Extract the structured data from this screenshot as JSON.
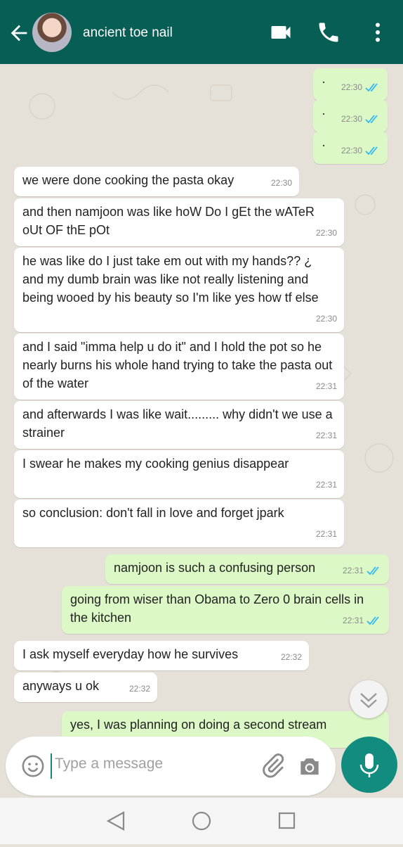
{
  "header": {
    "contact_name": "ancient toe nail",
    "icons": [
      "back-arrow-icon",
      "avatar",
      "video-call-icon",
      "phone-icon",
      "more-vert-icon"
    ],
    "color": "#075e54"
  },
  "messages": [
    {
      "dir": "out",
      "text": "·",
      "time": "22:30",
      "status": "read"
    },
    {
      "dir": "out",
      "text": "·",
      "time": "22:30",
      "status": "read"
    },
    {
      "dir": "out",
      "text": "·",
      "time": "22:30",
      "status": "read"
    },
    {
      "dir": "in",
      "text": "we were done cooking the pasta okay",
      "time": "22:30"
    },
    {
      "dir": "in",
      "text": "and then namjoon was like hoW Do I gEt the wATeR oUt OF thE pOt",
      "time": "22:30"
    },
    {
      "dir": "in",
      "text": "he was like do I just take em out with my hands?? ¿ and my dumb brain was like not really listening and being wooed by his beauty so I'm like yes how tf else",
      "time": "22:30"
    },
    {
      "dir": "in",
      "text": "and I said \"imma help u do it\" and I hold the pot so he nearly burns his whole hand trying to take the pasta out of the water",
      "time": "22:31"
    },
    {
      "dir": "in",
      "text": "and afterwards I was like wait......... why didn't we use a strainer",
      "time": "22:31"
    },
    {
      "dir": "in",
      "text": "I swear he makes my cooking genius disappear",
      "time": "22:31"
    },
    {
      "dir": "in",
      "text": "so conclusion: don't fall in love and forget jpark",
      "time": "22:31"
    },
    {
      "dir": "out",
      "text": "namjoon is such a confusing person",
      "time": "22:31",
      "status": "read"
    },
    {
      "dir": "out",
      "text": "going from wiser than Obama to Zero 0 brain cells in the kitchen",
      "time": "22:31",
      "status": "read"
    },
    {
      "dir": "in",
      "text": "I ask myself everyday how he survives",
      "time": "22:32"
    },
    {
      "dir": "in",
      "text": "anyways u ok",
      "time": "22:32"
    },
    {
      "dir": "out",
      "text": "yes, I was planning on doing a second stream",
      "time": "",
      "status": ""
    }
  ],
  "composer": {
    "placeholder": "Type a message"
  },
  "colors": {
    "incoming": "#ffffff",
    "outgoing": "#dcf8c6",
    "read_ticks": "#34b7f1",
    "accent": "#128c7e"
  }
}
